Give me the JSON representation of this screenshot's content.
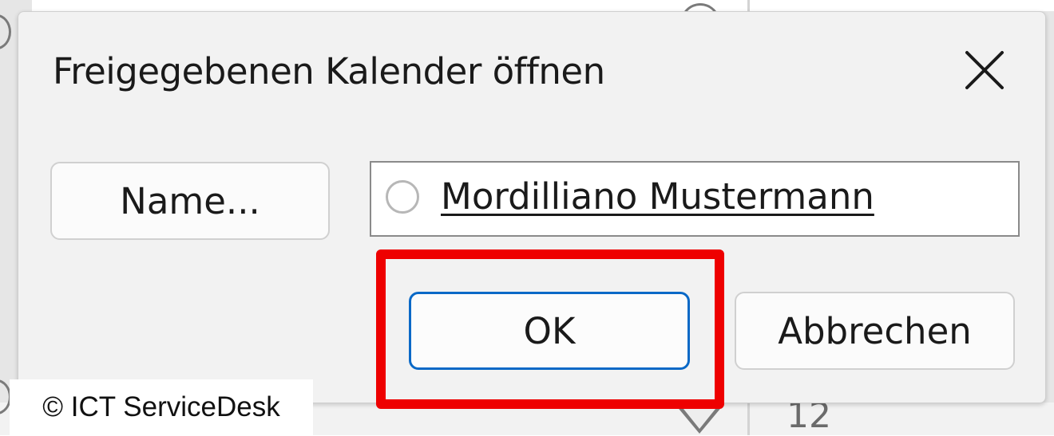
{
  "dialog": {
    "title": "Freigegebenen Kalender öffnen",
    "close_icon": "close-icon"
  },
  "name_button": {
    "label": "Name..."
  },
  "recipient": {
    "name": "Mordilliano Mustermann",
    "presence_icon": "presence-status-icon"
  },
  "ok_button": {
    "label": "OK"
  },
  "cancel_button": {
    "label": "Abbrechen"
  },
  "background": {
    "calendar_number": "12"
  },
  "watermark": {
    "text": "© ICT ServiceDesk"
  },
  "colors": {
    "highlight": "#ee0000",
    "accent": "#0a69c7",
    "dialog_bg": "#f2f2f2"
  }
}
